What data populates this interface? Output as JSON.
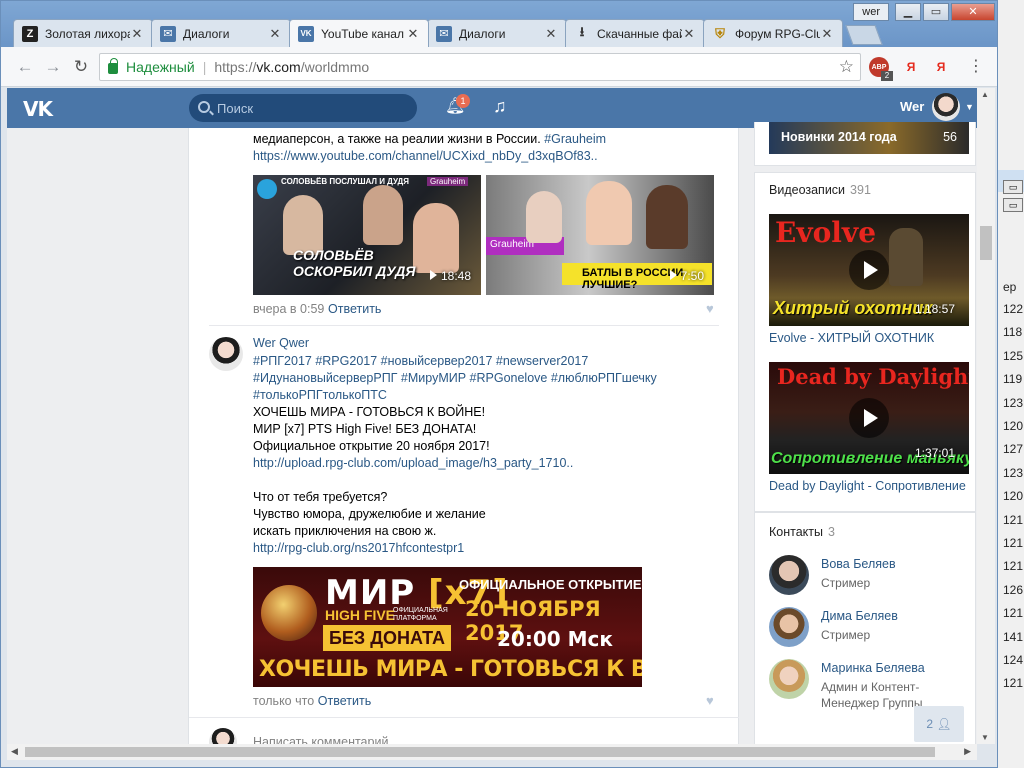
{
  "browser": {
    "profile": "wer",
    "tabs": [
      {
        "label": "Золотая лихорадка",
        "fav": "Z",
        "fav_color": "#222222"
      },
      {
        "label": "Диалоги",
        "fav": "✉",
        "fav_color": "#4a76a8"
      },
      {
        "label": "YouTube канал",
        "fav": "VK",
        "fav_color": "#4a76a8"
      },
      {
        "label": "Диалоги",
        "fav": "✉",
        "fav_color": "#4a76a8"
      },
      {
        "label": "Скачанные файлы",
        "fav": "⭳",
        "fav_color": "#555555"
      },
      {
        "label": "Форум RPG-Club",
        "fav": "⛨",
        "fav_color": "#b8860b"
      }
    ],
    "active_tab": 2,
    "secure_label": "Надежный",
    "url_scheme": "https://",
    "url_host": "vk.com",
    "url_path": "/worldmmo",
    "ext_abp": "ABP",
    "ext_abp_count": "2",
    "ext_ya1": "Я",
    "ext_ya2": "Я"
  },
  "vk": {
    "search_placeholder": "Поиск",
    "notif_count": "1",
    "username": "Wer"
  },
  "post1": {
    "line1": "медиаперсон, а также на реалии жизни в России. ",
    "hashtag": "#Grauheim",
    "link": "https://www.youtube.com/channel/UCXixd_nbDy_d3xqBOf83..",
    "video1_duration": "18:48",
    "video1_caption": "СОЛОВЬЁВ ОСКОРБИЛ ДУДЯ",
    "video1_tag": "Grauheim",
    "video1_badge": "СОЛОВЬЁВ ПОСЛУШАЛ И ДУДЯ",
    "video2_duration": "7:50",
    "video2_caption": "БАТЛЫ В РОССИИ ЛУЧШИЕ?",
    "video2_tag": "Grauheim",
    "time": "вчера в 0:59",
    "reply": "Ответить"
  },
  "post2": {
    "author": "Wer Qwer",
    "tags_line1": "#РПГ2017 #RPG2017 #новыйсервер2017 #newserver2017",
    "tags_line2": "#ИдунановыйсерверРПГ #МируМИР #RPGonelove #люблюРПГшечку",
    "tags_line3": "#толькоРПГтолькоПТС",
    "line4": "ХОЧЕШЬ МИРА - ГОТОВЬСЯ К ВОЙНЕ!",
    "line5": "МИР [x7] PTS High Five! БЕЗ ДОНАТА!",
    "line6": "Официальное открытие 20 ноября 2017!",
    "link1": "http://upload.rpg-club.com/upload_image/h3_party_1710..",
    "line7": "Что от тебя требуется?",
    "line8": "Чувство юмора, дружелюбие и желание",
    "line9": "искать приключения на свою ж.",
    "link2": "http://rpg-club.org/ns2017hfcontestpr1",
    "time": "только что",
    "reply": "Ответить"
  },
  "banner": {
    "title": "МИР",
    "title_x": "[x7]",
    "hf": "HIGH FIVE",
    "platform": "ОФИЦИАЛЬНАЯ ПЛАТФОРМА",
    "nodonate": "БЕЗ ДОНАТА",
    "official": "ОФИЦИАЛЬНОЕ ОТКРЫТИЕ",
    "date": "20 НОЯБРЯ 2017",
    "time": "20:00 Мск",
    "slogan": "ХОЧЕШЬ МИРА - ГОТОВЬСЯ К ВОЙНЕ"
  },
  "comment_placeholder": "Написать комментарий...",
  "sidebar": {
    "album_title": "Новинки 2014 года",
    "album_count": "56",
    "videos_label": "Видеозаписи",
    "videos_count": "391",
    "videos": [
      {
        "title": "Evolve - ХИТРЫЙ ОХОТНИК",
        "duration": "1:18:57",
        "art_top": "Evolve",
        "art_bottom": "Хитрый охотник"
      },
      {
        "title": "Dead by Daylight - Сопротивление",
        "duration": "1:37:01",
        "art_top": "Dead by Daylight",
        "art_bottom": "Сопротивление маньяку"
      }
    ],
    "contacts_label": "Контакты",
    "contacts_count": "3",
    "contacts": [
      {
        "name": "Вова Беляев",
        "role": "Стример",
        "role2": ""
      },
      {
        "name": "Дима Беляев",
        "role": "Стример",
        "role2": ""
      },
      {
        "name": "Маринка Беляева",
        "role": "Админ и Контент-",
        "role2": "Менеджер Группы"
      }
    ]
  },
  "chat_count": "2",
  "bg_window": {
    "rows": [
      "122",
      "118",
      "125",
      "119",
      "123",
      "120",
      "127",
      "123",
      "120",
      "121",
      "121",
      "121",
      "126",
      "121",
      "141",
      "124",
      "121"
    ],
    "header": "ер"
  }
}
